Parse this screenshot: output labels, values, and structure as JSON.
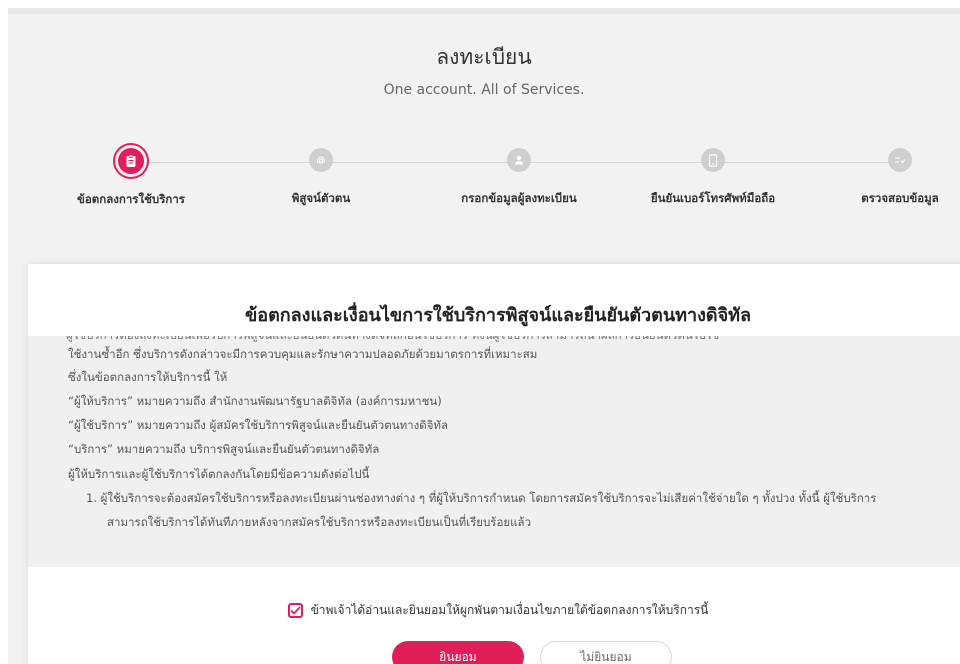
{
  "header": {
    "title": "ลงทะเบียน",
    "subtitle": "One account. All of Services."
  },
  "steps": [
    {
      "label": "ข้อตกลงการใช้บริการ",
      "icon": "document-icon",
      "active": true
    },
    {
      "label": "พิสูจน์ตัวตน",
      "icon": "fingerprint-icon",
      "active": false
    },
    {
      "label": "กรอกข้อมูลผู้ลงทะเบียน",
      "icon": "user-icon",
      "active": false
    },
    {
      "label": "ยืนยันเบอร์โทรศัพท์มือถือ",
      "icon": "mobile-phone-icon",
      "active": false
    },
    {
      "label": "ตรวจสอบข้อมูล",
      "icon": "checklist-icon",
      "active": false
    }
  ],
  "terms": {
    "title": "ข้อตกลงและเงื่อนไขการใช้บริการพิสูจน์และยืนยันตัวตนทางดิจิทัล",
    "lines": [
      "ใช้งานซ้ำอีก ซึ่งบริการดังกล่าวจะมีการควบคุมและรักษาความปลอดภัยด้วยมาตรการที่เหมาะสม",
      "ซึ่งในข้อตกลงการให้บริการนี้ ให้",
      "“ผู้ให้บริการ” หมายความถึง สำนักงานพัฒนารัฐบาลดิจิทัล (องค์การมหาชน)",
      "“ผู้ใช้บริการ” หมายความถึง ผู้สมัครใช้บริการพิสูจน์และยืนยันตัวตนทางดิจิทัล",
      "“บริการ” หมายความถึง บริการพิสูจน์และยืนยันตัวตนทางดิจิทัล",
      "ผู้ให้บริการและผู้ใช้บริการได้ตกลงกันโดยมีข้อความดังต่อไปนี้",
      "1. ผู้ใช้บริการจะต้องสมัครใช้บริการหรือลงทะเบียนผ่านช่องทางต่าง ๆ ที่ผู้ให้บริการกำหนด โดยการสมัครใช้บริการจะไม่เสียค่าใช้จ่ายใด ๆ ทั้งปวง ทั้งนี้ ผู้ใช้บริการ",
      "สามารถใช้บริการได้ทันทีภายหลังจากสมัครใช้บริการหรือลงทะเบียนเป็นที่เรียบร้อยแล้ว"
    ]
  },
  "consent": {
    "checked": true,
    "label": "ข้าพเจ้าได้อ่านและยินยอมให้ผูกพันตามเงื่อนไขภายใต้ข้อตกลงการให้บริการนี้"
  },
  "buttons": {
    "accept": "ยินยอม",
    "decline": "ไม่ยินยอม"
  },
  "colors": {
    "accent": "#e01e5a",
    "inactive_step": "#cfcfcf",
    "background": "#f2f2f2"
  }
}
